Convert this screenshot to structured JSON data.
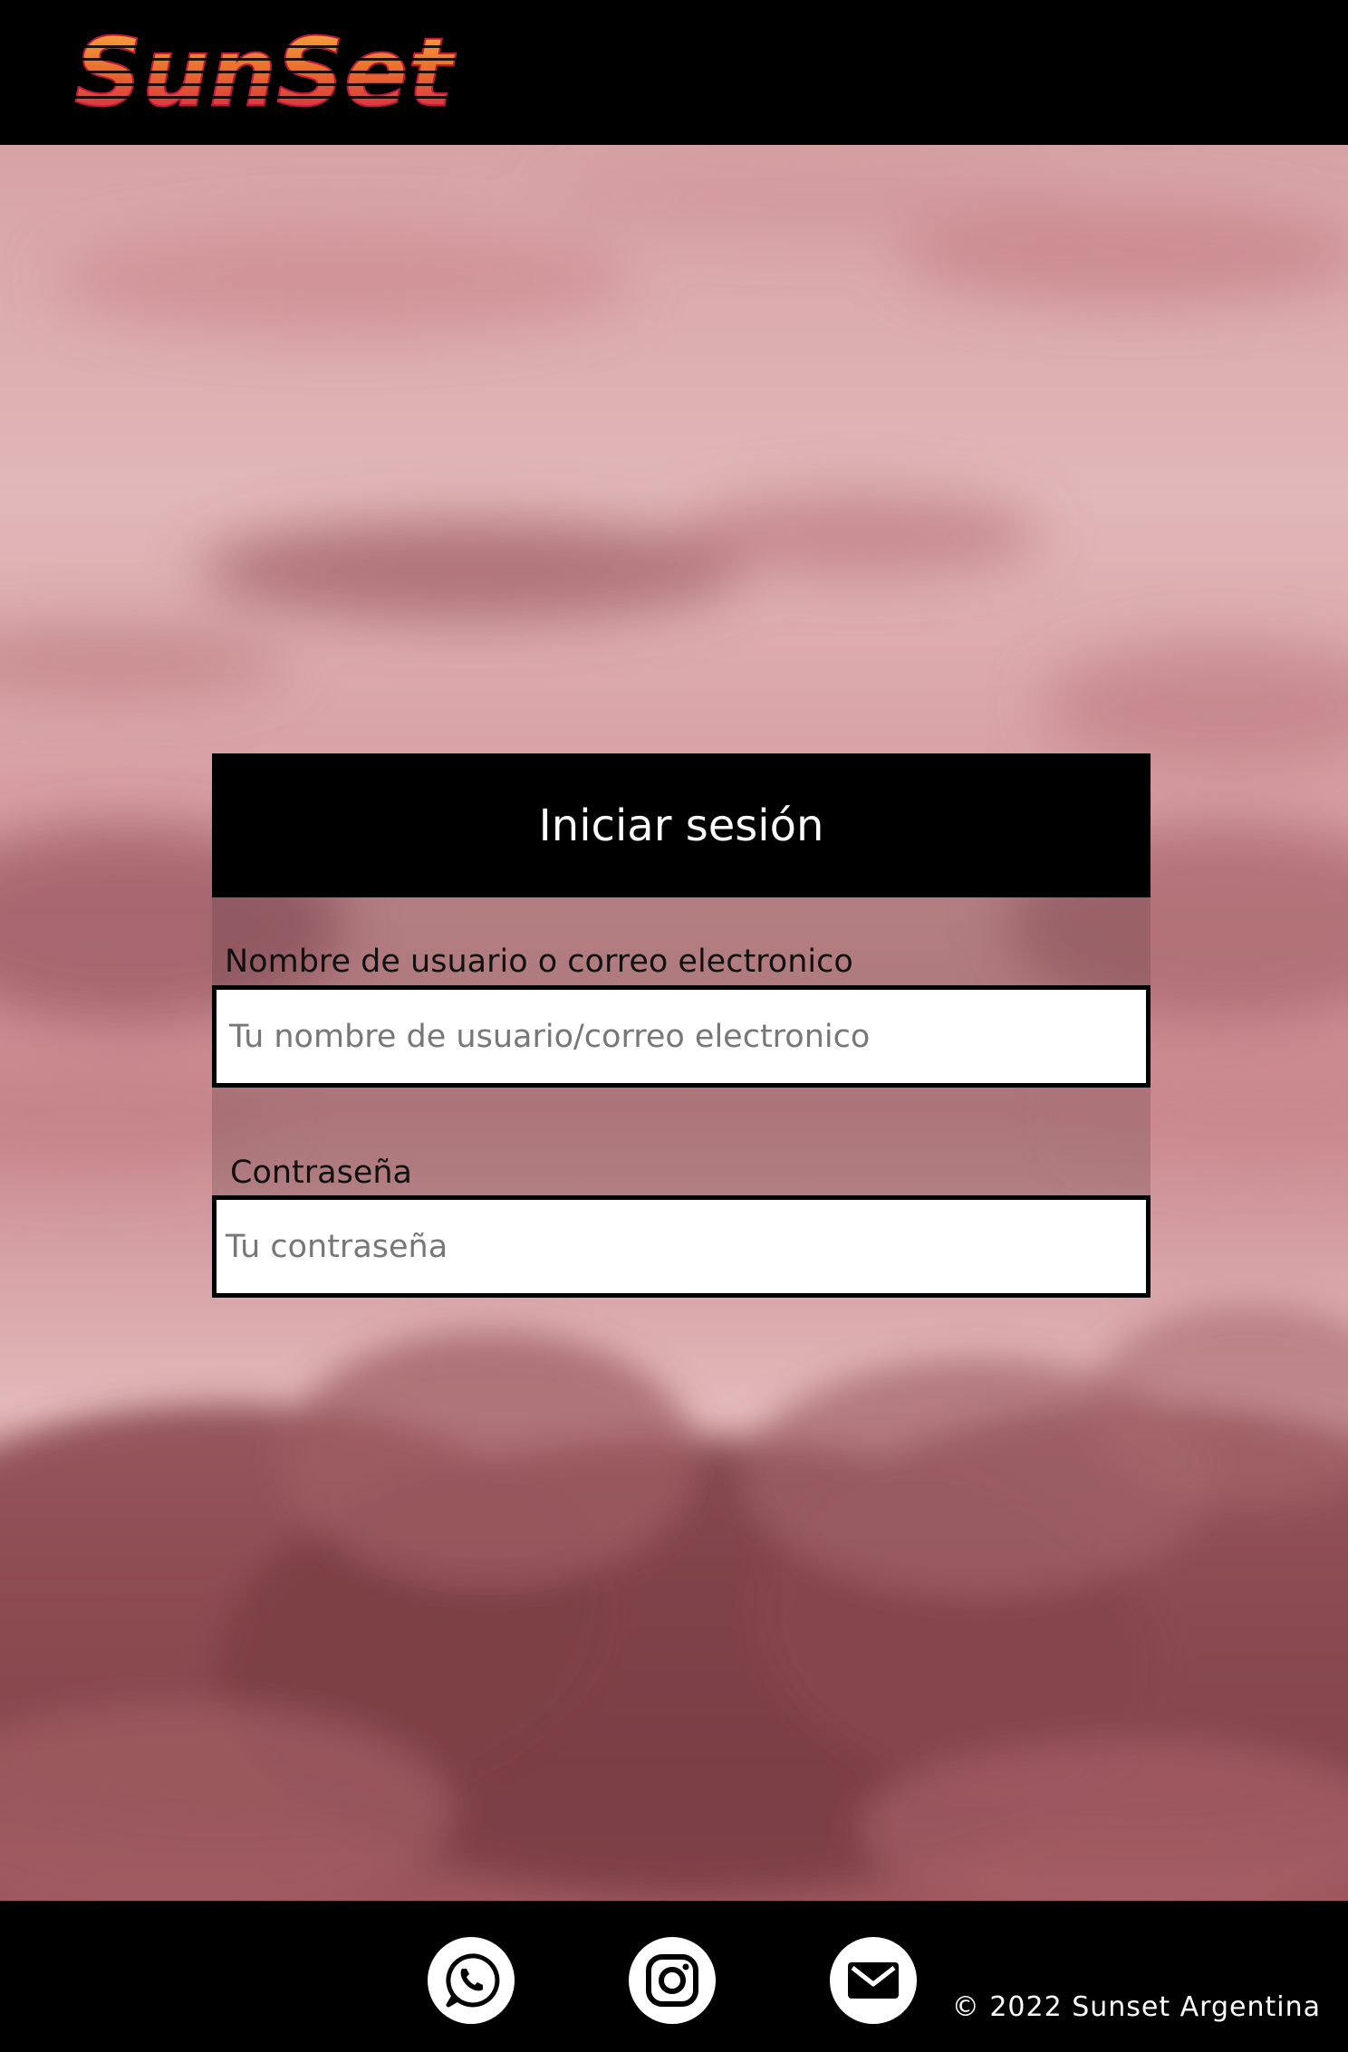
{
  "header": {
    "logo_text": "SunSet"
  },
  "login": {
    "title": "Iniciar sesión",
    "username_label": "Nombre de usuario o correo electronico",
    "username_placeholder": "Tu nombre de usuario/correo electronico",
    "password_label": "Contraseña",
    "password_placeholder": "Tu contraseña"
  },
  "footer": {
    "social": [
      {
        "icon": "whatsapp-icon"
      },
      {
        "icon": "instagram-icon"
      },
      {
        "icon": "mail-icon"
      }
    ],
    "copyright": "© 2022 Sunset Argentina"
  },
  "colors": {
    "logo_top": "#f0a13b",
    "logo_bottom": "#d4194e",
    "header_bg": "#000000",
    "sky_pink": "#d9a3a6"
  }
}
